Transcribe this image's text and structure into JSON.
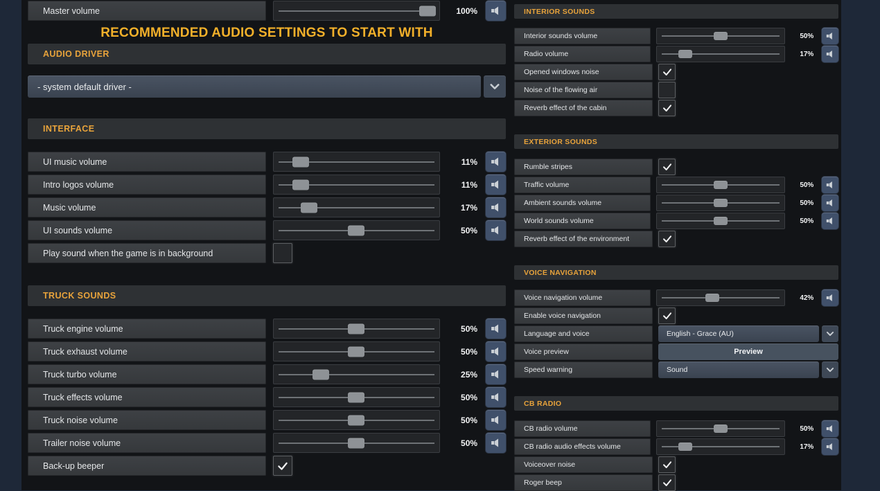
{
  "title_banner": "RECOMMENDED AUDIO SETTINGS TO START WITH",
  "colors": {
    "accent_section_header": "#e8a33b",
    "banner_gold": "#f2b02a",
    "panel_navy": "#1e2838",
    "content_black": "#121417",
    "speaker_button_blue": "#40506a"
  },
  "master_row": {
    "type": "slider",
    "label": "Master volume",
    "pct": 100,
    "value": "100%"
  },
  "left_sections": [
    {
      "title": "AUDIO DRIVER",
      "rows": [
        {
          "type": "select-bare",
          "value": "- system default driver -"
        }
      ]
    },
    {
      "title": "INTERFACE",
      "rows": [
        {
          "type": "slider",
          "label": "UI music volume",
          "pct": 11,
          "value": "11%"
        },
        {
          "type": "slider",
          "label": "Intro logos volume",
          "pct": 11,
          "value": "11%"
        },
        {
          "type": "slider",
          "label": "Music volume",
          "pct": 17,
          "value": "17%"
        },
        {
          "type": "slider",
          "label": "UI sounds volume",
          "pct": 50,
          "value": "50%"
        },
        {
          "type": "checkbox",
          "label": "Play sound when the game is in background",
          "checked": false
        }
      ]
    },
    {
      "title": "TRUCK SOUNDS",
      "rows": [
        {
          "type": "slider",
          "label": "Truck engine volume",
          "pct": 50,
          "value": "50%"
        },
        {
          "type": "slider",
          "label": "Truck exhaust volume",
          "pct": 50,
          "value": "50%"
        },
        {
          "type": "slider",
          "label": "Truck turbo volume",
          "pct": 25,
          "value": "25%"
        },
        {
          "type": "slider",
          "label": "Truck effects volume",
          "pct": 50,
          "value": "50%"
        },
        {
          "type": "slider",
          "label": "Truck noise volume",
          "pct": 50,
          "value": "50%"
        },
        {
          "type": "slider",
          "label": "Trailer noise volume",
          "pct": 50,
          "value": "50%"
        },
        {
          "type": "checkbox",
          "label": "Back-up beeper",
          "checked": true
        }
      ]
    }
  ],
  "right_sections": [
    {
      "title": "INTERIOR SOUNDS",
      "rows": [
        {
          "type": "slider",
          "label": "Interior sounds volume",
          "pct": 50,
          "value": "50%"
        },
        {
          "type": "slider",
          "label": "Radio volume",
          "pct": 17,
          "value": "17%"
        },
        {
          "type": "checkbox",
          "label": "Opened windows noise",
          "checked": true
        },
        {
          "type": "checkbox",
          "label": "Noise of the flowing air",
          "checked": false
        },
        {
          "type": "checkbox",
          "label": "Reverb effect of the cabin",
          "checked": true
        }
      ]
    },
    {
      "title": "EXTERIOR SOUNDS",
      "rows": [
        {
          "type": "checkbox",
          "label": "Rumble stripes",
          "checked": true
        },
        {
          "type": "slider",
          "label": "Traffic volume",
          "pct": 50,
          "value": "50%"
        },
        {
          "type": "slider",
          "label": "Ambient sounds volume",
          "pct": 50,
          "value": "50%"
        },
        {
          "type": "slider",
          "label": "World sounds volume",
          "pct": 50,
          "value": "50%"
        },
        {
          "type": "checkbox",
          "label": "Reverb effect of the environment",
          "checked": true
        }
      ]
    },
    {
      "title": "VOICE NAVIGATION",
      "rows": [
        {
          "type": "slider",
          "label": "Voice navigation volume",
          "pct": 42,
          "value": "42%"
        },
        {
          "type": "checkbox",
          "label": "Enable voice navigation",
          "checked": true
        },
        {
          "type": "select",
          "label": "Language and voice",
          "value": "English - Grace (AU)"
        },
        {
          "type": "button",
          "label": "Voice preview",
          "value": "Preview"
        },
        {
          "type": "select",
          "label": "Speed warning",
          "value": "Sound"
        }
      ]
    },
    {
      "title": "CB RADIO",
      "rows": [
        {
          "type": "slider",
          "label": "CB radio volume",
          "pct": 50,
          "value": "50%"
        },
        {
          "type": "slider",
          "label": "CB radio audio effects volume",
          "pct": 17,
          "value": "17%"
        },
        {
          "type": "checkbox",
          "label": "Voiceover noise",
          "checked": true
        },
        {
          "type": "checkbox",
          "label": "Roger beep",
          "checked": true
        }
      ]
    }
  ]
}
